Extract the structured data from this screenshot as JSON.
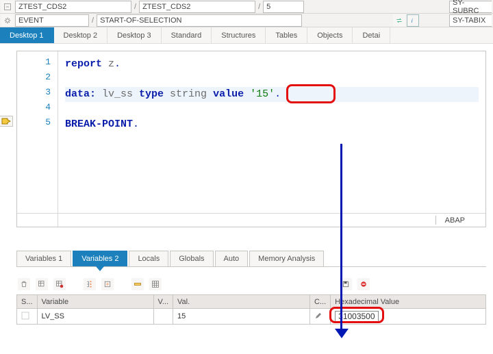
{
  "top1": {
    "prog1": "ZTEST_CDS2",
    "prog2": "ZTEST_CDS2",
    "line": "5",
    "sy1": "SY-SUBRC"
  },
  "top2": {
    "event": "EVENT",
    "block": "START-OF-SELECTION",
    "sy2": "SY-TABIX"
  },
  "tabs": [
    "Desktop 1",
    "Desktop 2",
    "Desktop 3",
    "Standard",
    "Structures",
    "Tables",
    "Objects",
    "Detai"
  ],
  "code": {
    "lines": [
      {
        "n": "1",
        "seg": [
          {
            "t": "report",
            "c": "kw"
          },
          {
            "t": " z",
            "c": "id"
          },
          {
            "t": ".",
            "c": "period"
          }
        ]
      },
      {
        "n": "2",
        "seg": []
      },
      {
        "n": "3",
        "hl": true,
        "seg": [
          {
            "t": "data:",
            "c": "kw"
          },
          {
            "t": " lv_ss ",
            "c": "id"
          },
          {
            "t": "type",
            "c": "kw"
          },
          {
            "t": " string ",
            "c": "id"
          },
          {
            "t": "value",
            "c": "kw"
          },
          {
            "t": " '15'",
            "c": "str"
          },
          {
            "t": ".",
            "c": "period"
          }
        ]
      },
      {
        "n": "4",
        "seg": []
      },
      {
        "n": "5",
        "seg": [
          {
            "t": "BREAK-POINT",
            "c": "kw"
          },
          {
            "t": ".",
            "c": "period"
          }
        ]
      }
    ],
    "footer": "ABAP"
  },
  "vartabs": [
    "Variables 1",
    "Variables 2",
    "Locals",
    "Globals",
    "Auto",
    "Memory Analysis"
  ],
  "table": {
    "cols": [
      "S...",
      "Variable",
      "V...",
      "Val.",
      "C...",
      "Hexadecimal Value"
    ],
    "row": {
      "var": "LV_SS",
      "val": "15",
      "hex": "31003500"
    }
  },
  "icons": {
    "gear": "gear-icon",
    "swap": "swap-icon",
    "info": "info-icon",
    "trash": "trash-icon",
    "grid1": "grid-plus-icon",
    "grid2": "grid-minus-icon",
    "tree": "tree-icon",
    "select": "select-icon",
    "row": "row-icon",
    "config": "config-icon",
    "save": "save-icon",
    "stop": "stop-icon",
    "pencil": "pencil-icon",
    "arrow": "debug-arrow-icon"
  }
}
